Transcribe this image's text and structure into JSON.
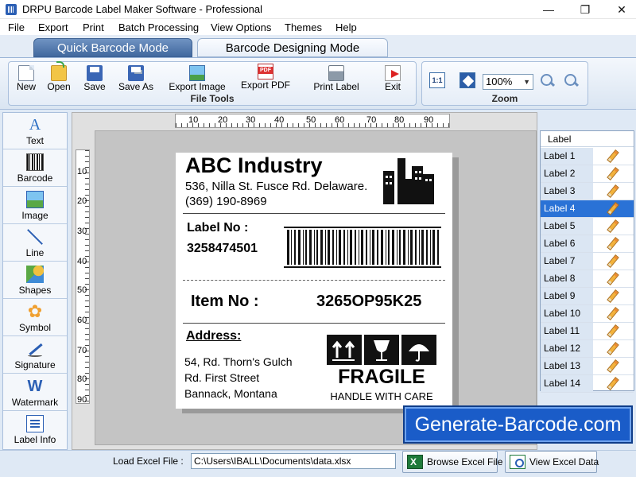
{
  "window": {
    "title": "DRPU Barcode Label Maker Software - Professional",
    "minimize": "—",
    "maximize": "❐",
    "close": "✕"
  },
  "menu": [
    "File",
    "Export",
    "Print",
    "Batch Processing",
    "View Options",
    "Themes",
    "Help"
  ],
  "modes": {
    "active": "Quick Barcode Mode",
    "inactive": "Barcode Designing Mode"
  },
  "file_tools": {
    "group_label": "File Tools",
    "buttons": [
      {
        "label": "New",
        "icon": "new-document-icon"
      },
      {
        "label": "Open",
        "icon": "open-folder-icon"
      },
      {
        "label": "Save",
        "icon": "save-icon"
      },
      {
        "label": "Save As",
        "icon": "save-as-icon"
      },
      {
        "label": "Export Image",
        "icon": "export-image-icon"
      },
      {
        "label": "Export PDF",
        "icon": "pdf-icon"
      },
      {
        "label": "Print Label",
        "icon": "printer-icon"
      },
      {
        "label": "Exit",
        "icon": "exit-icon"
      }
    ]
  },
  "zoom": {
    "group_label": "Zoom",
    "actual_size_label": "1:1",
    "value": "100%",
    "zoom_in": "+",
    "zoom_out": "−"
  },
  "toolbox": [
    {
      "label": "Text",
      "icon": "text-icon",
      "glyph": "A"
    },
    {
      "label": "Barcode",
      "icon": "barcode-icon",
      "glyph": ""
    },
    {
      "label": "Image",
      "icon": "image-icon",
      "glyph": ""
    },
    {
      "label": "Line",
      "icon": "line-icon",
      "glyph": ""
    },
    {
      "label": "Shapes",
      "icon": "shapes-icon",
      "glyph": ""
    },
    {
      "label": "Symbol",
      "icon": "symbol-icon",
      "glyph": "✿"
    },
    {
      "label": "Signature",
      "icon": "signature-icon",
      "glyph": ""
    },
    {
      "label": "Watermark",
      "icon": "watermark-icon",
      "glyph": "W"
    },
    {
      "label": "Label Info",
      "icon": "label-info-icon",
      "glyph": ""
    }
  ],
  "rulers": {
    "horizontal": [
      "10",
      "20",
      "30",
      "40",
      "50",
      "60",
      "70",
      "80",
      "90"
    ],
    "vertical": [
      "10",
      "20",
      "30",
      "40",
      "50",
      "60",
      "70",
      "80",
      "90"
    ]
  },
  "label": {
    "company": "ABC Industry",
    "address_line": "536, Nilla St. Fusce Rd. Delaware.",
    "phone": "(369) 190-8969",
    "label_no_title": "Label No :",
    "label_no_value": "3258474501",
    "item_no_title": "Item No :",
    "item_no_value": "3265OP95K25",
    "address_title": "Address:",
    "address_lines": [
      "54, Rd. Thorn's Gulch",
      "Rd. First Street",
      "Bannack, Montana"
    ],
    "fragile_text": "FRAGILE",
    "handle_text": "HANDLE WITH CARE"
  },
  "label_list": {
    "header": "Label",
    "selected_index": 3,
    "items": [
      "Label 1",
      "Label 2",
      "Label 3",
      "Label 4",
      "Label 5",
      "Label 6",
      "Label 7",
      "Label 8",
      "Label 9",
      "Label 10",
      "Label 11",
      "Label 12",
      "Label 13",
      "Label 14"
    ]
  },
  "brand_banner": "Generate-Barcode.com",
  "bottom": {
    "excel_label": "Load Excel File :",
    "excel_path": "C:\\Users\\IBALL\\Documents\\data.xlsx",
    "browse_label": "Browse Excel File",
    "view_label": "View Excel Data"
  },
  "colors": {
    "accent": "#2a72d6",
    "brand_banner": "#1a5cc8",
    "mode_tab_active": "#41689e"
  }
}
